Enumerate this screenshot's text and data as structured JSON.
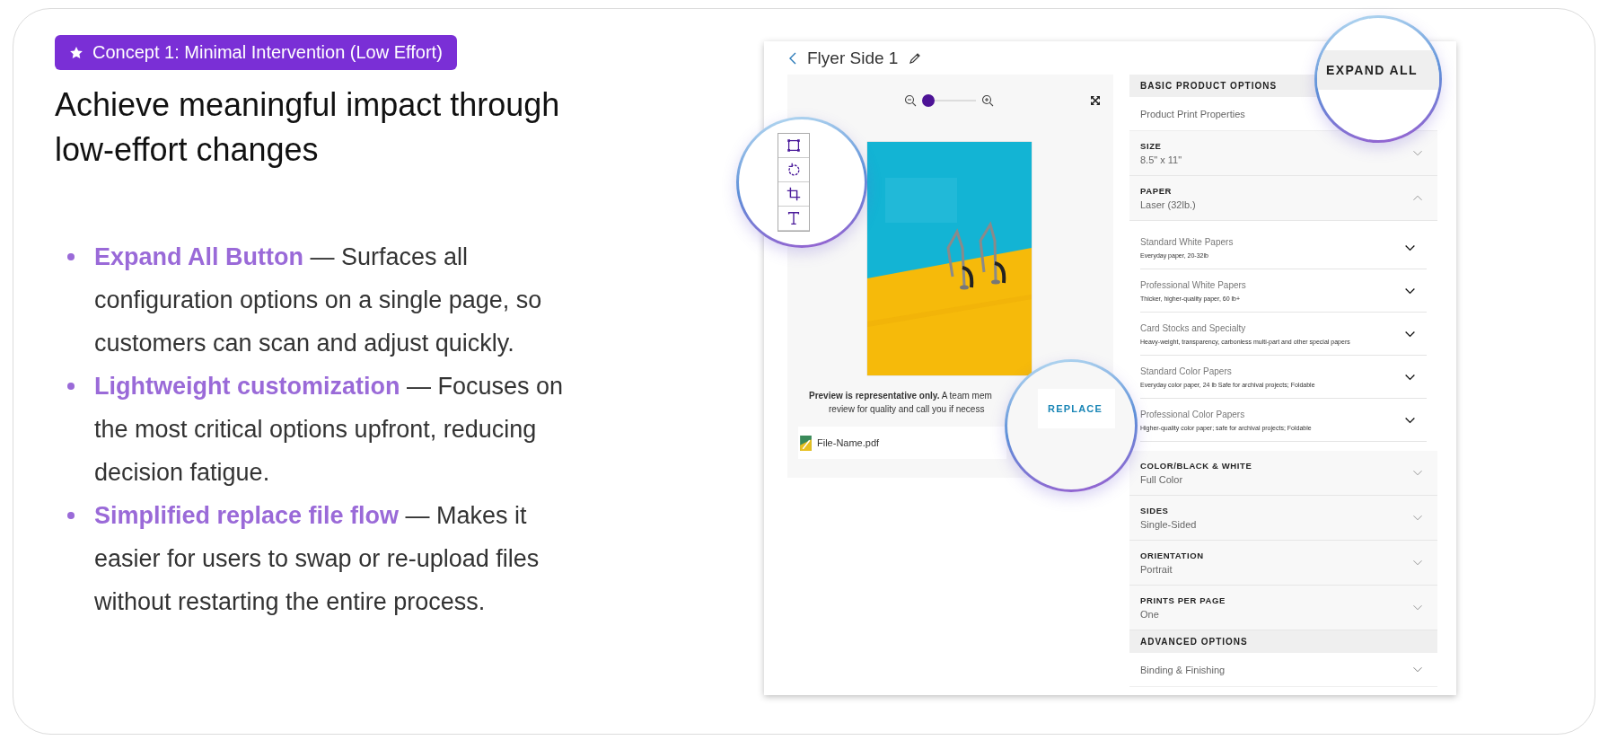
{
  "badge": {
    "label": "Concept 1: Minimal Intervention (Low Effort)"
  },
  "headline": "Achieve meaningful impact through low-effort changes",
  "bullets": [
    "**Expand All Button** — Surfaces all configuration options on a single page, so customers can scan and adjust quickly.",
    "**Lightweight customization** — Focuses on the most critical options upfront, reducing decision fatigue.",
    "**Simplified replace file flow** — Makes it easier for users to swap or re-upload files without restarting the entire process."
  ],
  "mockup": {
    "title": "Flyer Side 1",
    "zoom": {
      "level": 0
    },
    "preview": {
      "kind": "picture"
    },
    "notice_lines": [
      "**Preview is representative only.** A team mem",
      "review for quality and call you if necess"
    ],
    "file_name": "File-Name.pdf",
    "replace_button": "REPLACE",
    "expand_all_button": "EXPAND ALL",
    "options": [
      {
        "kind": "header",
        "label": "BASIC PRODUCT OPTIONS"
      },
      {
        "kind": "plain",
        "label": "Product Print Properties"
      },
      {
        "kind": "select",
        "label": "SIZE",
        "value": "8.5\" x 11\"",
        "expanded": false
      },
      {
        "kind": "select",
        "label": "PAPER",
        "value": "Laser (32lb.)",
        "expanded": true,
        "children": [
          {
            "title": "Standard White Papers",
            "description": "Everyday paper, 20-32lb",
            "expanded": false
          },
          {
            "title": "Professional White Papers",
            "description": "Thicker, higher-quality paper, 60 lb+",
            "expanded": false
          },
          {
            "title": "Card Stocks and Specialty",
            "description": "Heavy-weight, transparency, carbonless multi-part and other special papers",
            "expanded": false
          },
          {
            "title": "Standard Color Papers",
            "description": "Everyday color paper, 24 lb Safe for archival projects; Foldable",
            "expanded": false
          },
          {
            "title": "Professional Color Papers",
            "description": "Higher-quality color paper; safe for archival projects; Foldable",
            "expanded": false
          }
        ]
      },
      {
        "kind": "select",
        "label": "COLOR/BLACK & WHITE",
        "value": "Full Color",
        "expanded": false
      },
      {
        "kind": "select",
        "label": "SIDES",
        "value": "Single-Sided",
        "expanded": false
      },
      {
        "kind": "select",
        "label": "ORIENTATION",
        "value": "Portrait",
        "expanded": false
      },
      {
        "kind": "select",
        "label": "PRINTS PER PAGE",
        "value": "One",
        "expanded": false
      },
      {
        "kind": "header",
        "label": "ADVANCED OPTIONS"
      },
      {
        "kind": "plain",
        "label": "Binding & Finishing",
        "expanded": false
      }
    ]
  }
}
